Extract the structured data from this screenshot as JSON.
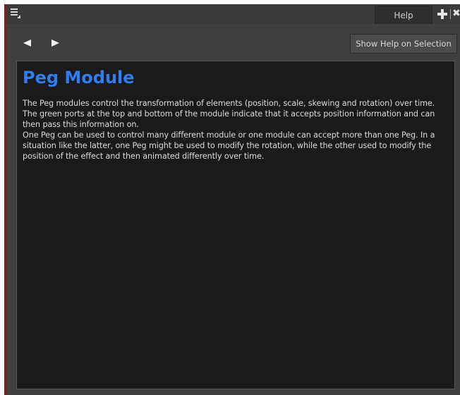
{
  "titlebar": {
    "help_tab_label": "Help",
    "icons": {
      "menu": "hamburger-menu-icon",
      "add": "plus-icon",
      "close": "close-icon"
    }
  },
  "toolbar": {
    "back_icon": "arrow-left-icon",
    "forward_icon": "arrow-right-icon",
    "show_help_label": "Show Help on Selection"
  },
  "content": {
    "title": "Peg Module",
    "paragraphs": [
      "The Peg modules control the transformation of elements (position, scale, skewing and rotation) over time. The green ports at the top and bottom of the module indicate that it accepts position information and can then pass this information on.",
      "One Peg can be used to control many different module or one module can accept more than one Peg. In a situation like the latter, one Peg might be used to modify the rotation, while the other used to modify the position of the effect and then animated differently over time."
    ]
  },
  "colors": {
    "panel_bg": "#3f3f3f",
    "content_bg": "#1a1a1a",
    "title_color": "#2f7df0",
    "text_color": "#dcdcdc",
    "left_edge": "#7a1f1f"
  }
}
